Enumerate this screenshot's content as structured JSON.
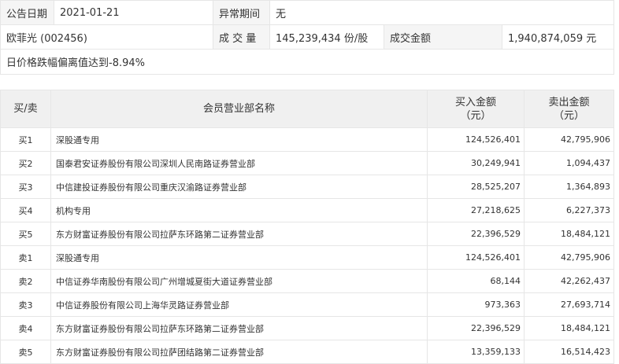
{
  "info": {
    "date_label": "公告日期",
    "date": "2021-01-21",
    "period_label": "异常期间",
    "period": "无",
    "stock": "欧菲光 (002456)",
    "volume_label": "成 交 量",
    "volume": "145,239,434 份/股",
    "amount_label": "成交金额",
    "amount": "1,940,874,059 元",
    "reason": "日价格跌幅偏离值达到-8.94%"
  },
  "table": {
    "headers": {
      "side": "买/卖",
      "name": "会员营业部名称",
      "buy_line1": "买入金额",
      "buy_line2": "（元）",
      "sell_line1": "卖出金额",
      "sell_line2": "（元）"
    },
    "rows": [
      {
        "side": "买1",
        "name": "深股通专用",
        "buy": "124,526,401",
        "sell": "42,795,906"
      },
      {
        "side": "买2",
        "name": "国泰君安证券股份有限公司深圳人民南路证券营业部",
        "buy": "30,249,941",
        "sell": "1,094,437"
      },
      {
        "side": "买3",
        "name": "中信建投证券股份有限公司重庆汉渝路证券营业部",
        "buy": "28,525,207",
        "sell": "1,364,893"
      },
      {
        "side": "买4",
        "name": "机构专用",
        "buy": "27,218,625",
        "sell": "6,227,373"
      },
      {
        "side": "买5",
        "name": "东方财富证券股份有限公司拉萨东环路第二证券营业部",
        "buy": "22,396,529",
        "sell": "18,484,121"
      },
      {
        "side": "卖1",
        "name": "深股通专用",
        "buy": "124,526,401",
        "sell": "42,795,906"
      },
      {
        "side": "卖2",
        "name": "中信证券华南股份有限公司广州增城夏街大道证券营业部",
        "buy": "68,144",
        "sell": "42,262,437"
      },
      {
        "side": "卖3",
        "name": "中信证券股份有限公司上海华灵路证券营业部",
        "buy": "973,363",
        "sell": "27,693,714"
      },
      {
        "side": "卖4",
        "name": "东方财富证券股份有限公司拉萨东环路第二证券营业部",
        "buy": "22,396,529",
        "sell": "18,484,121"
      },
      {
        "side": "卖5",
        "name": "东方财富证券股份有限公司拉萨团结路第二证券营业部",
        "buy": "13,359,133",
        "sell": "16,514,423"
      }
    ]
  }
}
